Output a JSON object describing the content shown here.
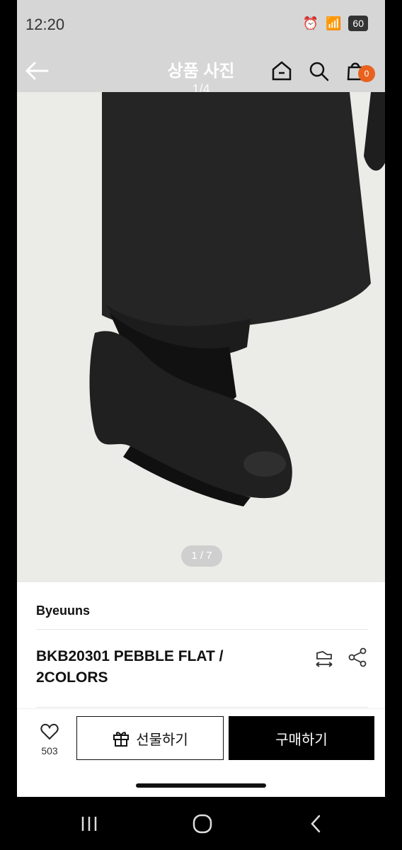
{
  "status": {
    "time": "12:20",
    "battery": "60"
  },
  "header": {
    "title": "상품 사진",
    "page_indicator": "1/4",
    "cart_count": "0"
  },
  "image": {
    "counter": "1 / 7"
  },
  "product": {
    "brand": "Byeuuns",
    "name": "BKB20301 PEBBLE FLAT / 2COLORS"
  },
  "actions": {
    "like_count": "503",
    "gift_label": "선물하기",
    "buy_label": "구매하기"
  },
  "colors": {
    "accent": "#e8621e",
    "primary": "#000000"
  },
  "icons": [
    "back-arrow-icon",
    "home-icon",
    "search-icon",
    "cart-icon",
    "compare-size-icon",
    "share-icon",
    "heart-icon",
    "gift-icon"
  ]
}
